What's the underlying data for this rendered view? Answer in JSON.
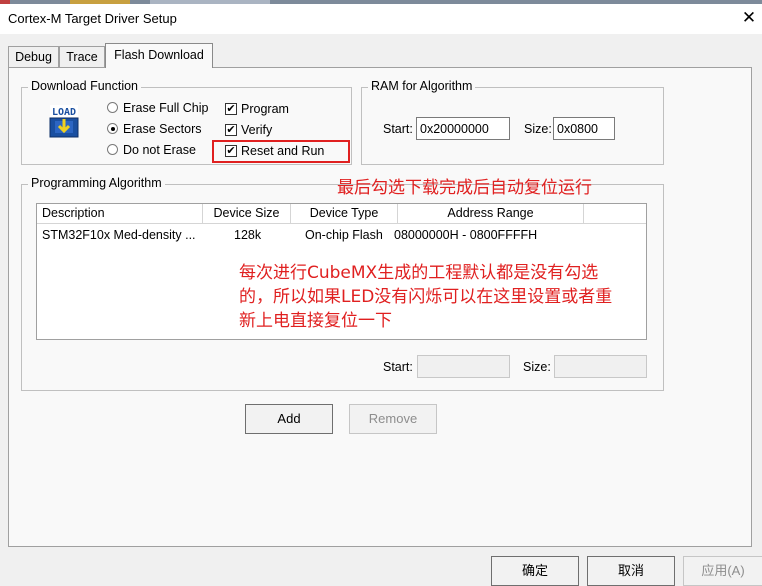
{
  "window": {
    "title": "Cortex-M Target Driver Setup"
  },
  "tabs": [
    {
      "label": "Debug",
      "active": false
    },
    {
      "label": "Trace",
      "active": false
    },
    {
      "label": "Flash Download",
      "active": true
    }
  ],
  "download_function": {
    "title": "Download Function",
    "load_icon_text": "LOAD",
    "erase_options": [
      {
        "label": "Erase Full Chip",
        "checked": false
      },
      {
        "label": "Erase Sectors",
        "checked": true
      },
      {
        "label": "Do not Erase",
        "checked": false
      }
    ],
    "checks": [
      {
        "label": "Program",
        "checked": true
      },
      {
        "label": "Verify",
        "checked": true
      },
      {
        "label": "Reset and Run",
        "checked": true
      }
    ],
    "check_mark": "✔"
  },
  "ram_for_algorithm": {
    "title": "RAM for Algorithm",
    "start_label": "Start:",
    "start_value": "0x20000000",
    "size_label": "Size:",
    "size_value": "0x0800"
  },
  "programming_algorithm": {
    "title": "Programming Algorithm",
    "columns": [
      "Description",
      "Device Size",
      "Device Type",
      "Address Range"
    ],
    "rows": [
      {
        "description": "STM32F10x Med-density ...",
        "device_size": "128k",
        "device_type": "On-chip Flash",
        "address_range": "08000000H - 0800FFFFH"
      }
    ],
    "start_label": "Start:",
    "start_value": "",
    "size_label": "Size:",
    "size_value": ""
  },
  "buttons": {
    "add": "Add",
    "remove": "Remove",
    "ok": "确定",
    "cancel": "取消",
    "apply": "应用(A)"
  },
  "annotations": {
    "reset_note": "最后勾选下载完成后自动复位运行",
    "cubemx_note_lines": [
      "每次进行CubeMX生成的工程默认都是没有勾选",
      "的，所以如果LED没有闪烁可以在这里设置或者重",
      "新上电直接复位一下"
    ]
  },
  "colors": {
    "annotation": "#e02020",
    "load_icon_blue": "#1a4fa0",
    "load_icon_yellow": "#f0d020"
  }
}
